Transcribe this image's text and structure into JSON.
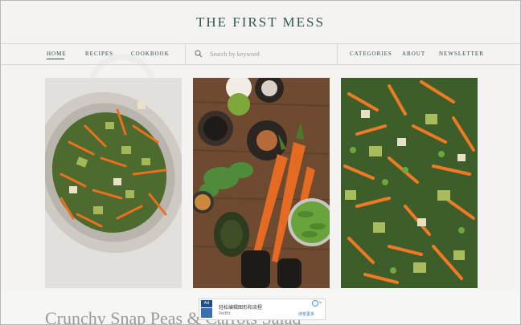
{
  "site": {
    "logo": "THE FIRST MESS"
  },
  "nav": {
    "left": [
      "HOME",
      "RECIPES",
      "COOKBOOK"
    ],
    "right": [
      "CATEGORIES",
      "ABOUT",
      "NEWSLETTER"
    ],
    "active": "HOME"
  },
  "search": {
    "placeholder": "Search by keyword"
  },
  "icons": {
    "search": "search-icon"
  },
  "colors": {
    "accent": "#2f5a52",
    "background": "#f4f3f1"
  },
  "post": {
    "title": "Crunchy Snap Peas & Carrots Salad"
  },
  "ad": {
    "badge": "Ad",
    "text": "轻松编辑图形和流程",
    "sub": "PetBit",
    "cta": "浏览更多",
    "close": "✕"
  }
}
